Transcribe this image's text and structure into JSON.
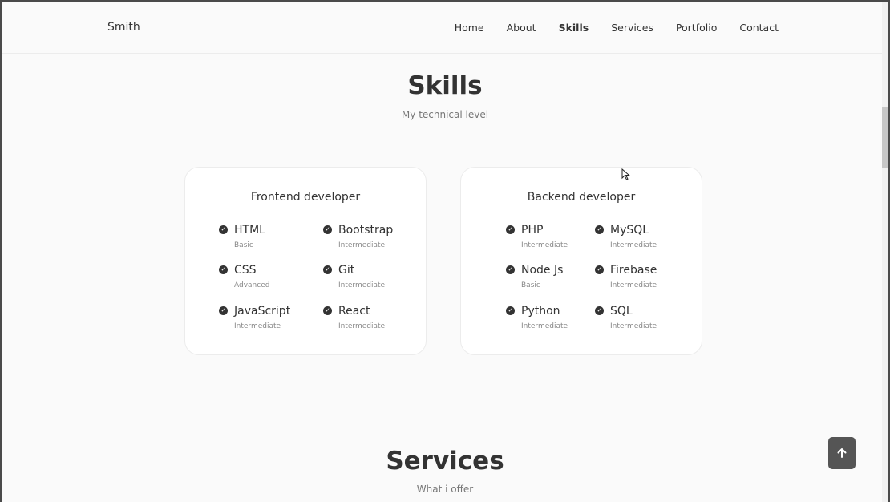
{
  "header": {
    "logo": "Smith",
    "nav": [
      "Home",
      "About",
      "Skills",
      "Services",
      "Portfolio",
      "Contact"
    ],
    "active": "Skills"
  },
  "skills_section": {
    "title": "Skills",
    "subtitle": "My technical level"
  },
  "cards": [
    {
      "title": "Frontend developer",
      "skills": [
        {
          "name": "HTML",
          "level": "Basic"
        },
        {
          "name": "Bootstrap",
          "level": "Intermediate"
        },
        {
          "name": "CSS",
          "level": "Advanced"
        },
        {
          "name": "Git",
          "level": "Intermediate"
        },
        {
          "name": "JavaScript",
          "level": "Intermediate"
        },
        {
          "name": "React",
          "level": "Intermediate"
        }
      ]
    },
    {
      "title": "Backend developer",
      "skills": [
        {
          "name": "PHP",
          "level": "Intermediate"
        },
        {
          "name": "MySQL",
          "level": "Intermediate"
        },
        {
          "name": "Node Js",
          "level": "Basic"
        },
        {
          "name": "Firebase",
          "level": "Intermediate"
        },
        {
          "name": "Python",
          "level": "Intermediate"
        },
        {
          "name": "SQL",
          "level": "Intermediate"
        }
      ]
    }
  ],
  "services_section": {
    "title": "Services",
    "subtitle": "What i offer"
  },
  "icons": {
    "check": "check-circle-icon",
    "scroll_top": "arrow-up-icon"
  },
  "colors": {
    "background": "#fafafa",
    "text": "#333333",
    "button": "#555555"
  }
}
